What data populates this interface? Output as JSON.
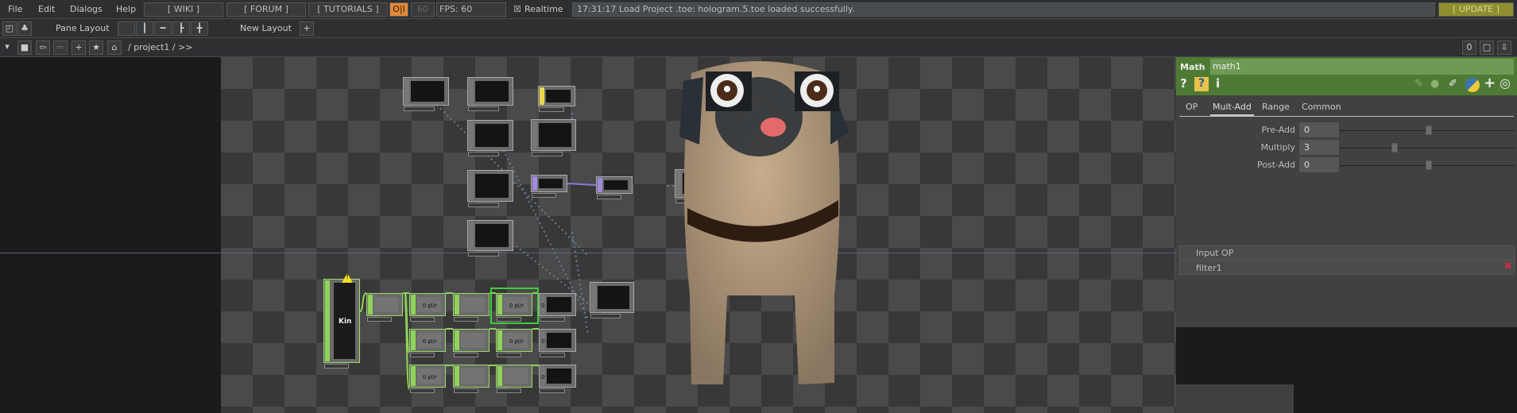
{
  "menu": [
    "File",
    "Edit",
    "Dialogs",
    "Help"
  ],
  "links": {
    "wiki": "[ WIKI ]",
    "forum": "[ FORUM ]",
    "tutorials": "[ TUTORIALS ]"
  },
  "toggle_oi": "O|I",
  "fps_cap": "60",
  "fps": "FPS:  60",
  "realtime": {
    "checkbox": "☒",
    "label": "Realtime"
  },
  "status": "17:31:17 Load Project .toe: hologram.5.toe loaded successfully.",
  "update": "[ UPDATE ]",
  "pane": {
    "label": "Pane Layout",
    "new_layout": "New Layout",
    "plus": "+"
  },
  "path": {
    "text": "/ project1 / >>",
    "zero": "0"
  },
  "network": {
    "kinect_label": "Kin",
    "value_r": "0  pl/r",
    "value_head": "0  pl/head",
    "warning": "!"
  },
  "panel": {
    "type": "Math",
    "name": "math1",
    "tabs": [
      "OP",
      "Mult-Add",
      "Range",
      "Common"
    ],
    "active_tab": "Mult-Add",
    "params": [
      {
        "label": "Pre-Add",
        "value": "0",
        "slider": 0.5
      },
      {
        "label": "Multiply",
        "value": "3",
        "slider": 0.3
      },
      {
        "label": "Post-Add",
        "value": "0",
        "slider": 0.5
      }
    ],
    "inputs_header": "Input OP",
    "inputs": [
      "filter1"
    ]
  },
  "colors": {
    "header": "#4f7a34",
    "name_field": "#6f9a55",
    "update": "#8f8f30",
    "oi": "#e08a3a",
    "node_green": "#8fd458"
  }
}
